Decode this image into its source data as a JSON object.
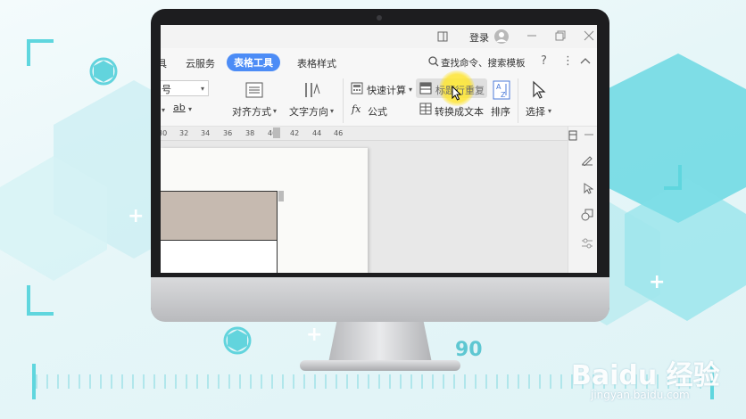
{
  "screen": {
    "titlebar": {
      "login_label": "登录"
    },
    "tabs": [
      {
        "label": "具"
      },
      {
        "label": "云服务"
      },
      {
        "label": "表格工具",
        "active": true
      },
      {
        "label": "表格样式"
      }
    ],
    "search_label": "查找命令、搜索模板",
    "ribbon": {
      "font_size_label": "号",
      "ab_label": "ab",
      "align_label": "对齐方式",
      "text_direction_label": "文字方向",
      "quick_calc_label": "快速计算",
      "formula_fx": "fx",
      "formula_label": "公式",
      "title_repeat_label": "标题行重复",
      "convert_text_label": "转换成文本",
      "sort_label": "排序",
      "select_label": "选择"
    },
    "ruler_ticks": [
      "30",
      "32",
      "34",
      "36",
      "38",
      "40",
      "42",
      "44",
      "46"
    ]
  },
  "decor": {
    "number": "90",
    "watermark": "Baidu 经验",
    "watermark_url": "jingyan.baidu.com"
  },
  "colors": {
    "accent": "#4c8cf6",
    "highlight": "#ffe83c",
    "table_header": "#c6bab0",
    "decor_cyan": "#5fd6de"
  }
}
